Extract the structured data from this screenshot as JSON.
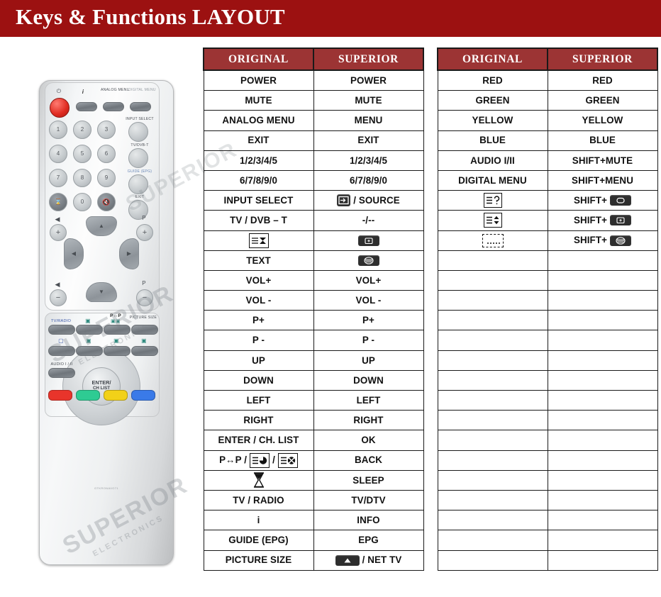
{
  "header": {
    "title": "Keys & Functions LAYOUT",
    "banner_color": "#9c1111"
  },
  "remote": {
    "watermark": "SUPERIOR",
    "watermark_sub": "ELECTRONICS",
    "model_code": "GTKRONAVO71",
    "labels": {
      "power": "⏻",
      "info": "i",
      "analog_menu": "ANALOG MENU",
      "digital_menu": "DIGITAL MENU",
      "input_select": "INPUT SELECT",
      "tv_dvb_t": "TV/DVB-T",
      "guide_epg": "GUIDE (EPG)",
      "exit": "EXIT",
      "p_label": "P",
      "enter": "ENTER/",
      "ch_list": "CH LIST",
      "tv_radio": "TV/RADIO",
      "p_to_p": "P↔P",
      "picture_size": "PICTURE SIZE",
      "audio_i_ii": "AUDIO I / II"
    },
    "keypad": [
      "1",
      "2",
      "3",
      "4",
      "5",
      "6",
      "7",
      "8",
      "9",
      "0"
    ],
    "colour_buttons": [
      {
        "name": "red",
        "color": "#e8342b"
      },
      {
        "name": "green",
        "color": "#2ecb93"
      },
      {
        "name": "yellow",
        "color": "#f2d118"
      },
      {
        "name": "blue",
        "color": "#3a7ae8"
      }
    ]
  },
  "tables": [
    {
      "id": "table-1",
      "headers": [
        "ORIGINAL",
        "SUPERIOR"
      ],
      "rows": [
        {
          "original": "POWER",
          "superior": "POWER"
        },
        {
          "original": "MUTE",
          "superior": "MUTE"
        },
        {
          "original": "ANALOG MENU",
          "superior": "MENU"
        },
        {
          "original": "EXIT",
          "superior": "EXIT"
        },
        {
          "original": "1/2/3/4/5",
          "superior": "1/2/3/4/5"
        },
        {
          "original": "6/7/8/9/0",
          "superior": "6/7/8/9/0"
        },
        {
          "original": "INPUT SELECT",
          "superior": "/ SOURCE",
          "superior_icon": "source-arrow-icon"
        },
        {
          "original": "TV / DVB – T",
          "superior": "-/--"
        },
        {
          "original": "",
          "original_icon": "list-hourglass-icon",
          "superior": "",
          "superior_icon": "subtitle-plus-button-icon"
        },
        {
          "original": "TEXT",
          "superior": "",
          "superior_icon": "teletext-button-icon"
        },
        {
          "original": "VOL+",
          "superior": "VOL+"
        },
        {
          "original": "VOL -",
          "superior": "VOL -"
        },
        {
          "original": "P+",
          "superior": "P+"
        },
        {
          "original": "P -",
          "superior": "P -"
        },
        {
          "original": "UP",
          "superior": "UP"
        },
        {
          "original": "DOWN",
          "superior": "DOWN"
        },
        {
          "original": "LEFT",
          "superior": "LEFT"
        },
        {
          "original": "RIGHT",
          "superior": "RIGHT"
        },
        {
          "original": "ENTER / CH. LIST",
          "superior": "OK"
        },
        {
          "original": "P↔P /  / ",
          "original_icon": "pip-icons",
          "superior": "BACK"
        },
        {
          "original": "",
          "original_icon": "hourglass-icon",
          "superior": "SLEEP"
        },
        {
          "original": "TV / RADIO",
          "superior": "TV/DTV"
        },
        {
          "original": "i",
          "superior": "INFO"
        },
        {
          "original": "GUIDE (EPG)",
          "superior": "EPG"
        },
        {
          "original": "PICTURE SIZE",
          "superior": "/ NET TV",
          "superior_icon": "up-triangle-button-icon"
        }
      ]
    },
    {
      "id": "table-2",
      "headers": [
        "ORIGINAL",
        "SUPERIOR"
      ],
      "rows": [
        {
          "original": "RED",
          "superior": "RED"
        },
        {
          "original": "GREEN",
          "superior": "GREEN"
        },
        {
          "original": "YELLOW",
          "superior": "YELLOW"
        },
        {
          "original": "BLUE",
          "superior": "BLUE"
        },
        {
          "original": "AUDIO I/II",
          "superior": "SHIFT+MUTE"
        },
        {
          "original": "DIGITAL MENU",
          "superior": "SHIFT+MENU"
        },
        {
          "original": "",
          "original_icon": "list-question-icon",
          "superior": "SHIFT+",
          "superior_icon": "rounded-screen-button-icon"
        },
        {
          "original": "",
          "original_icon": "list-updown-icon",
          "superior": "SHIFT+",
          "superior_icon": "subtitle-plus-button-icon"
        },
        {
          "original": "",
          "original_icon": "dotted-box-icon",
          "superior": "SHIFT+",
          "superior_icon": "teletext-button-icon"
        },
        {
          "original": "",
          "superior": ""
        },
        {
          "original": "",
          "superior": ""
        },
        {
          "original": "",
          "superior": ""
        },
        {
          "original": "",
          "superior": ""
        },
        {
          "original": "",
          "superior": ""
        },
        {
          "original": "",
          "superior": ""
        },
        {
          "original": "",
          "superior": ""
        },
        {
          "original": "",
          "superior": ""
        },
        {
          "original": "",
          "superior": ""
        },
        {
          "original": "",
          "superior": ""
        },
        {
          "original": "",
          "superior": ""
        },
        {
          "original": "",
          "superior": ""
        },
        {
          "original": "",
          "superior": ""
        },
        {
          "original": "",
          "superior": ""
        },
        {
          "original": "",
          "superior": ""
        },
        {
          "original": "",
          "superior": ""
        }
      ]
    }
  ]
}
